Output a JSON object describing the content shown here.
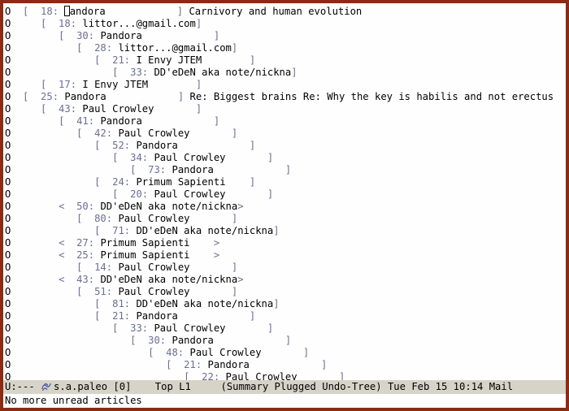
{
  "threads": [
    {
      "mark": "O",
      "depth": 0,
      "open": "[",
      "close": "]",
      "count": 18,
      "author": "Pandora",
      "author_w": 19,
      "cursor": true,
      "subject": "Carnivory and human evolution"
    },
    {
      "mark": "O",
      "depth": 1,
      "open": "[",
      "close": "]",
      "count": 18,
      "author": "littor...@gmail.com",
      "author_w": 19
    },
    {
      "mark": "O",
      "depth": 2,
      "open": "[",
      "close": "]",
      "count": 30,
      "author": "Pandora",
      "author_w": 19
    },
    {
      "mark": "O",
      "depth": 3,
      "open": "[",
      "close": "]",
      "count": 28,
      "author": "littor...@gmail.com",
      "author_w": 19
    },
    {
      "mark": "O",
      "depth": 4,
      "open": "[",
      "close": "]",
      "count": 21,
      "author": "I Envy JTEM",
      "author_w": 19
    },
    {
      "mark": "O",
      "depth": 5,
      "open": "[",
      "close": "]",
      "count": 33,
      "author": "DD'eDeN aka note/nickna",
      "author_w": 23
    },
    {
      "mark": "O",
      "depth": 1,
      "open": "[",
      "close": "]",
      "count": 17,
      "author": "I Envy JTEM",
      "author_w": 19
    },
    {
      "mark": "O",
      "depth": 0,
      "open": "[",
      "close": "]",
      "count": 25,
      "author": "Pandora",
      "author_w": 19,
      "subject": "Re: Biggest brains Re: Why the key is habilis and not erectus"
    },
    {
      "mark": "O",
      "depth": 1,
      "open": "[",
      "close": "]",
      "count": 43,
      "author": "Paul Crowley",
      "author_w": 19
    },
    {
      "mark": "O",
      "depth": 2,
      "open": "[",
      "close": "]",
      "count": 41,
      "author": "Pandora",
      "author_w": 19
    },
    {
      "mark": "O",
      "depth": 3,
      "open": "[",
      "close": "]",
      "count": 42,
      "author": "Paul Crowley",
      "author_w": 19
    },
    {
      "mark": "O",
      "depth": 4,
      "open": "[",
      "close": "]",
      "count": 52,
      "author": "Pandora",
      "author_w": 19
    },
    {
      "mark": "O",
      "depth": 5,
      "open": "[",
      "close": "]",
      "count": 34,
      "author": "Paul Crowley",
      "author_w": 19
    },
    {
      "mark": "O",
      "depth": 6,
      "open": "[",
      "close": "]",
      "count": 73,
      "author": "Pandora",
      "author_w": 19
    },
    {
      "mark": "O",
      "depth": 4,
      "open": "[",
      "close": "]",
      "count": 24,
      "author": "Primum Sapienti",
      "author_w": 19
    },
    {
      "mark": "O",
      "depth": 5,
      "open": "[",
      "close": "]",
      "count": 20,
      "author": "Paul Crowley",
      "author_w": 19
    },
    {
      "mark": "O",
      "depth": 2,
      "open": "<",
      "close": ">",
      "count": 50,
      "author": "DD'eDeN aka note/nickna",
      "author_w": 23
    },
    {
      "mark": "O",
      "depth": 3,
      "open": "[",
      "close": "]",
      "count": 80,
      "author": "Paul Crowley",
      "author_w": 19
    },
    {
      "mark": "O",
      "depth": 4,
      "open": "[",
      "close": "]",
      "count": 71,
      "author": "DD'eDeN aka note/nickna",
      "author_w": 23
    },
    {
      "mark": "O",
      "depth": 2,
      "open": "<",
      "close": ">",
      "count": 27,
      "author": "Primum Sapienti",
      "author_w": 19
    },
    {
      "mark": "O",
      "depth": 2,
      "open": "<",
      "close": ">",
      "count": 25,
      "author": "Primum Sapienti",
      "author_w": 19
    },
    {
      "mark": "O",
      "depth": 3,
      "open": "[",
      "close": "]",
      "count": 14,
      "author": "Paul Crowley",
      "author_w": 19
    },
    {
      "mark": "O",
      "depth": 2,
      "open": "<",
      "close": ">",
      "count": 43,
      "author": "DD'eDeN aka note/nickna",
      "author_w": 23
    },
    {
      "mark": "O",
      "depth": 3,
      "open": "[",
      "close": "]",
      "count": 51,
      "author": "Paul Crowley",
      "author_w": 19
    },
    {
      "mark": "O",
      "depth": 4,
      "open": "[",
      "close": "]",
      "count": 81,
      "author": "DD'eDeN aka note/nickna",
      "author_w": 23
    },
    {
      "mark": "O",
      "depth": 4,
      "open": "[",
      "close": "]",
      "count": 21,
      "author": "Pandora",
      "author_w": 19
    },
    {
      "mark": "O",
      "depth": 5,
      "open": "[",
      "close": "]",
      "count": 33,
      "author": "Paul Crowley",
      "author_w": 19
    },
    {
      "mark": "O",
      "depth": 6,
      "open": "[",
      "close": "]",
      "count": 30,
      "author": "Pandora",
      "author_w": 19
    },
    {
      "mark": "O",
      "depth": 7,
      "open": "[",
      "close": "]",
      "count": 48,
      "author": "Paul Crowley",
      "author_w": 19
    },
    {
      "mark": "O",
      "depth": 8,
      "open": "[",
      "close": "]",
      "count": 21,
      "author": "Pandora",
      "author_w": 19
    },
    {
      "mark": "O",
      "depth": 9,
      "open": "[",
      "close": "]",
      "count": 22,
      "author": "Paul Crowley",
      "author_w": 19
    }
  ],
  "modeline": {
    "left": "U:--- ",
    "buffer": "s.a.paleo [0]",
    "pos": "Top L1",
    "modes": "(Summary Plugged Undo-Tree)",
    "time": "Tue Feb 15 10:14",
    "major": "Mail"
  },
  "minibuffer": "No more unread articles"
}
